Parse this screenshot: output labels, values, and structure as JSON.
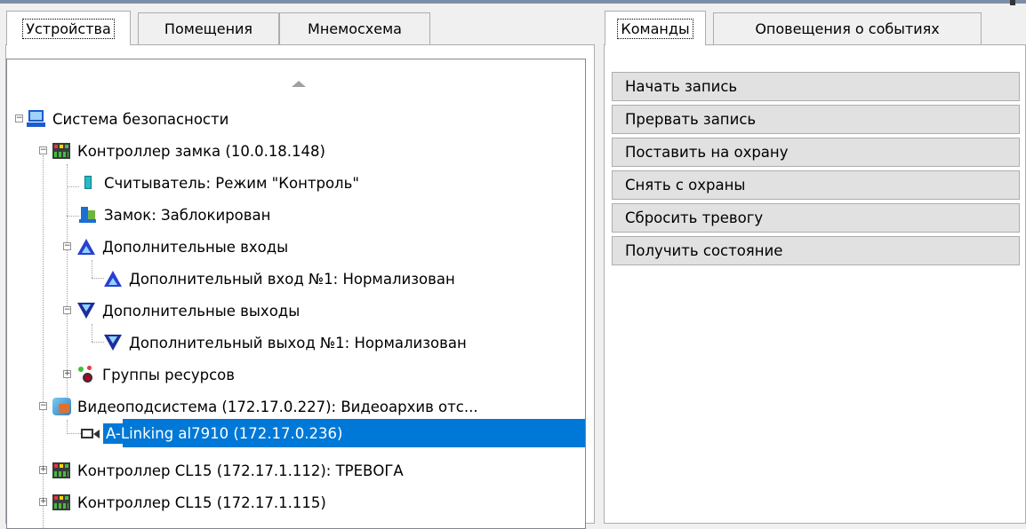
{
  "left_tabs": [
    {
      "label": "Устройства",
      "active": true
    },
    {
      "label": "Помещения",
      "active": false
    },
    {
      "label": "Мнемосхема",
      "active": false
    }
  ],
  "right_tabs": [
    {
      "label": "Команды",
      "active": true
    },
    {
      "label": "Оповещения о событиях",
      "active": false
    }
  ],
  "tree": {
    "root": {
      "label": "Система безопасности",
      "icon": "security-system-icon"
    },
    "items": [
      {
        "label": "Контроллер замка (10.0.18.148)",
        "icon": "controller-icon"
      },
      {
        "label": "Считыватель: Режим \"Контроль\"",
        "icon": "reader-icon"
      },
      {
        "label": "Замок: Заблокирован",
        "icon": "lock-icon"
      },
      {
        "label": "Дополнительные входы",
        "icon": "input-icon"
      },
      {
        "label": "Дополнительный вход №1: Нормализован",
        "icon": "input-icon"
      },
      {
        "label": "Дополнительные выходы",
        "icon": "output-icon"
      },
      {
        "label": "Дополнительный выход №1: Нормализован",
        "icon": "output-icon"
      },
      {
        "label": "Группы ресурсов",
        "icon": "resource-groups-icon"
      },
      {
        "label": "Видеоподсистема (172.17.0.227): Видеоархив отс...",
        "icon": "video-subsystem-icon"
      },
      {
        "label": "A-Linking al7910 (172.17.0.236)",
        "icon": "camera-icon",
        "selected": true
      },
      {
        "label": "Контроллер CL15 (172.17.1.112): ТРЕВОГА",
        "icon": "controller-icon"
      },
      {
        "label": "Контроллер CL15 (172.17.1.115)",
        "icon": "controller-icon"
      }
    ]
  },
  "commands": [
    "Начать запись",
    "Прервать запись",
    "Поставить на охрану",
    "Снять с охраны",
    "Сбросить тревогу",
    "Получить состояние"
  ],
  "colors": {
    "selection": "#0078d7",
    "button_bg": "#e1e1e1",
    "border": "#adadad"
  }
}
